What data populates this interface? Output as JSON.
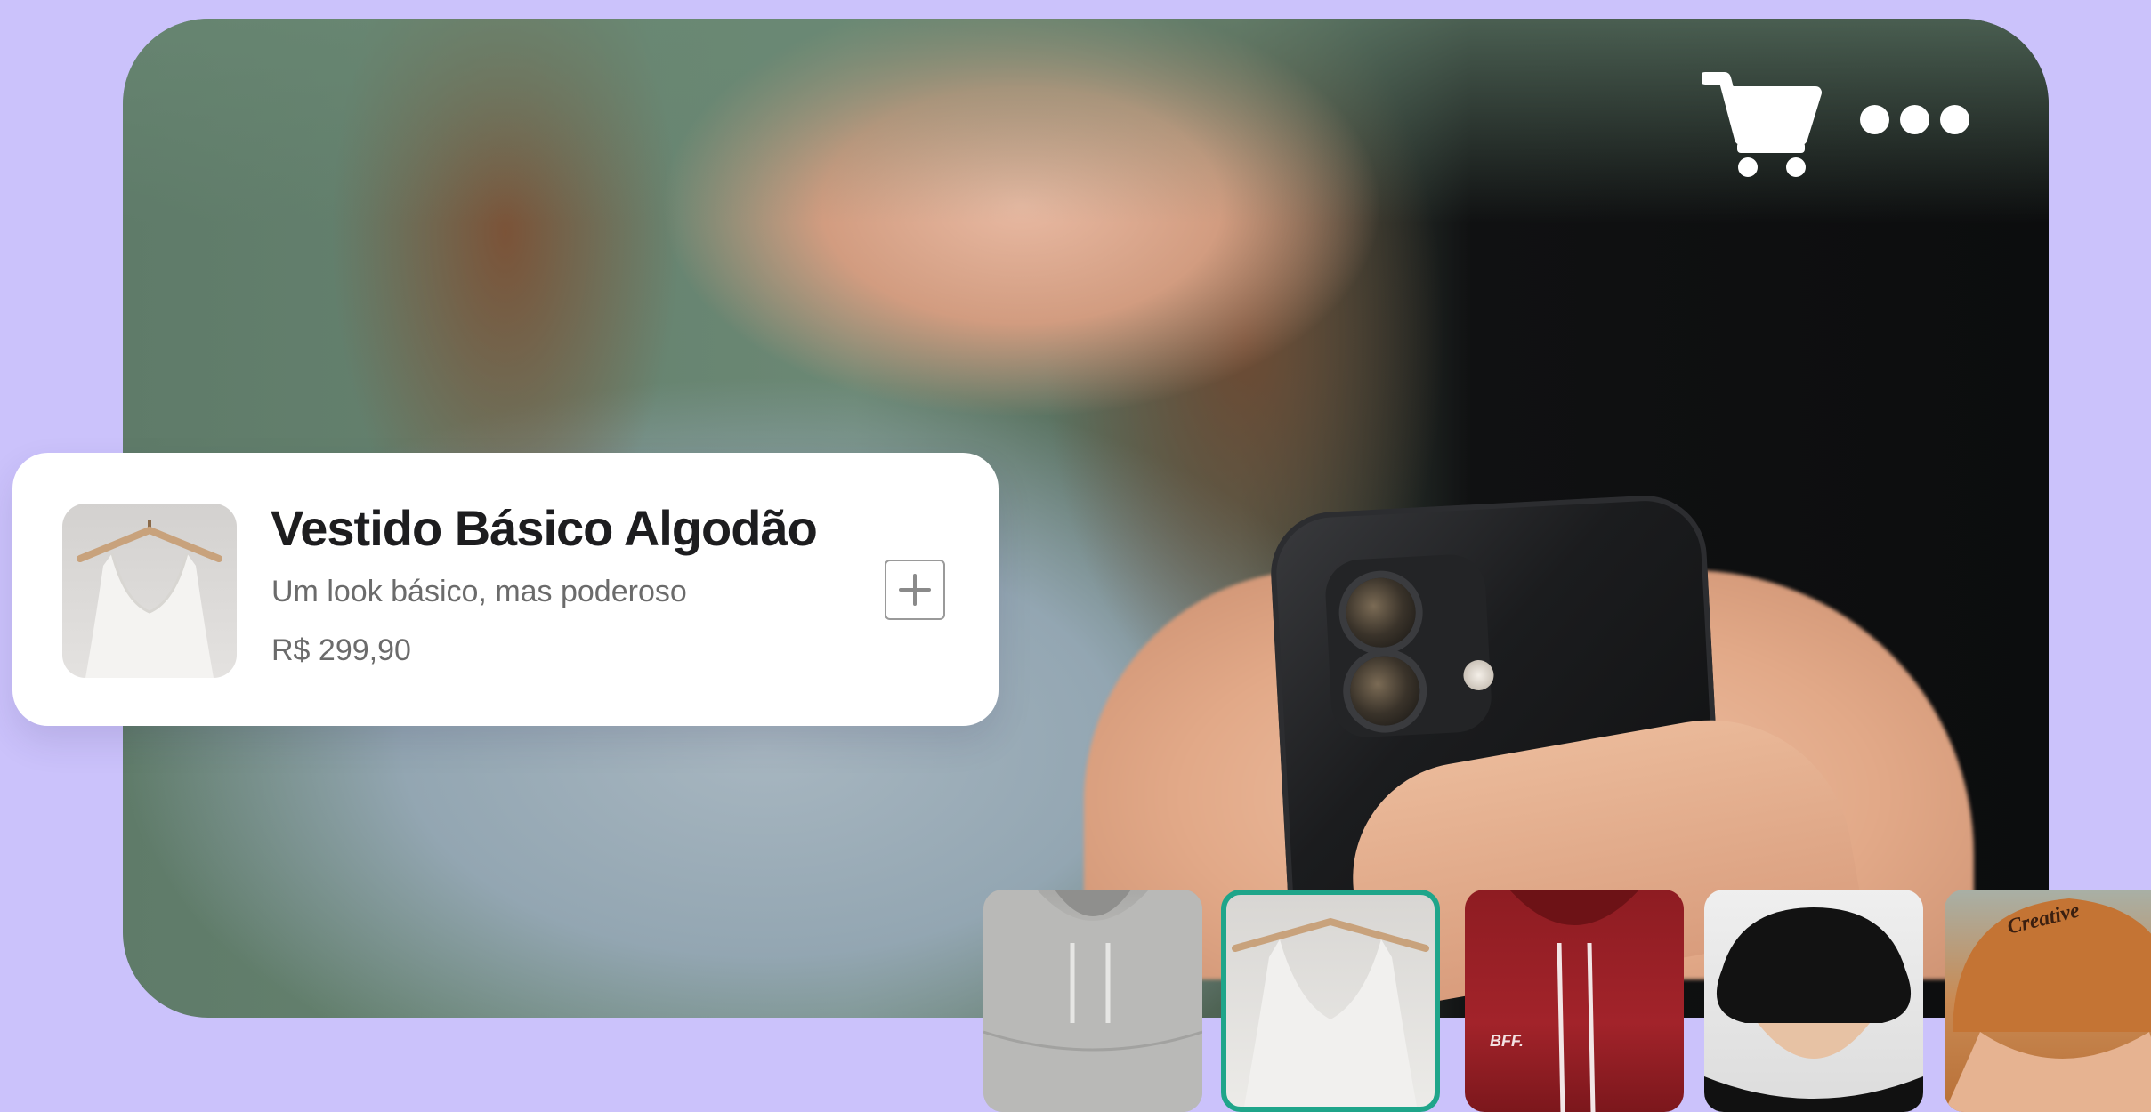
{
  "header_actions": {
    "cart_icon": "cart-icon",
    "more_icon": "more-options-icon"
  },
  "product_card": {
    "title": "Vestido Básico Algodão",
    "subtitle": "Um look básico, mas poderoso",
    "price": "R$ 299,90",
    "add_icon": "plus-icon"
  },
  "thumbnails": [
    {
      "item": "gray-hoodie",
      "selected": false
    },
    {
      "item": "white-tank-dress",
      "selected": true
    },
    {
      "item": "red-hoodie",
      "selected": false,
      "print_text": "BFF."
    },
    {
      "item": "black-bucket-hat",
      "selected": false
    },
    {
      "item": "orange-cap",
      "selected": false,
      "print_text": "Creative"
    }
  ],
  "colors": {
    "background": "#cbc2fb",
    "card": "#ffffff",
    "selected_border": "#1fa58a",
    "title_text": "#1d1d1f",
    "secondary_text": "#6b6b6b"
  }
}
